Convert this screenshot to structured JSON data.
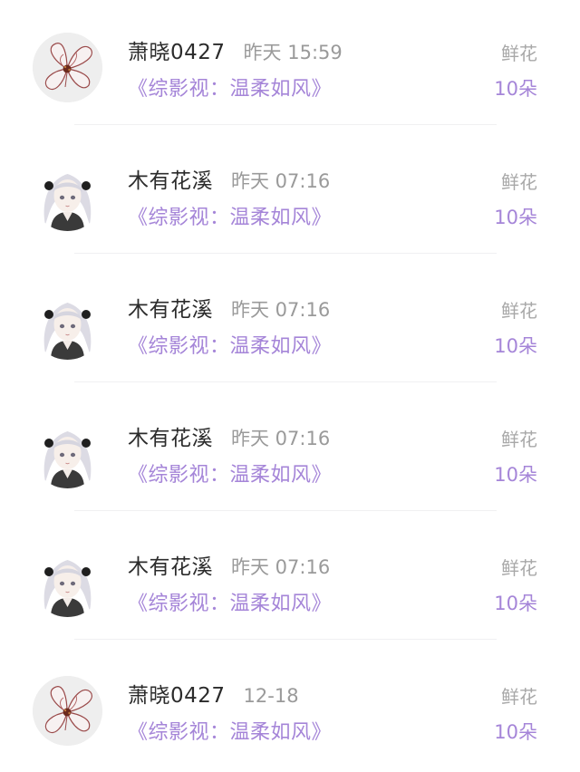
{
  "gift_records": [
    {
      "user_name": "萧晓0427",
      "time": "昨天 15:59",
      "book_title": "《综影视：温柔如风》",
      "gift_type": "鲜花",
      "gift_count": "10朵",
      "avatar_icon": "flower-avatar-icon"
    },
    {
      "user_name": "木有花溪",
      "time": "昨天 07:16",
      "book_title": "《综影视：温柔如风》",
      "gift_type": "鲜花",
      "gift_count": "10朵",
      "avatar_icon": "anime-girl-avatar-icon"
    },
    {
      "user_name": "木有花溪",
      "time": "昨天 07:16",
      "book_title": "《综影视：温柔如风》",
      "gift_type": "鲜花",
      "gift_count": "10朵",
      "avatar_icon": "anime-girl-avatar-icon"
    },
    {
      "user_name": "木有花溪",
      "time": "昨天 07:16",
      "book_title": "《综影视：温柔如风》",
      "gift_type": "鲜花",
      "gift_count": "10朵",
      "avatar_icon": "anime-girl-avatar-icon"
    },
    {
      "user_name": "木有花溪",
      "time": "昨天 07:16",
      "book_title": "《综影视：温柔如风》",
      "gift_type": "鲜花",
      "gift_count": "10朵",
      "avatar_icon": "anime-girl-avatar-icon"
    },
    {
      "user_name": "萧晓0427",
      "time": "12-18",
      "book_title": "《综影视：温柔如风》",
      "gift_type": "鲜花",
      "gift_count": "10朵",
      "avatar_icon": "flower-avatar-icon"
    }
  ],
  "colors": {
    "accent": "#a585d8",
    "name": "#2b2b2b",
    "muted": "#9a9a9a",
    "divider": "#f0f0f2"
  }
}
